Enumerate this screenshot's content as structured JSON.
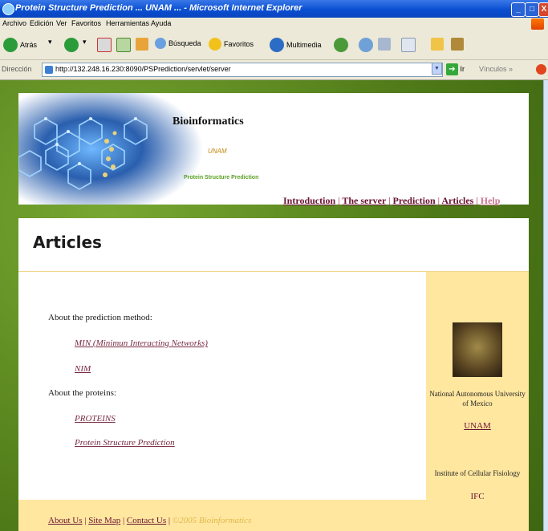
{
  "window": {
    "title": "Protein Structure Prediction ... UNAM ... - Microsoft Internet Explorer",
    "minimize": "_",
    "maximize": "□",
    "close": "X"
  },
  "menu": [
    "Archivo",
    "Edición",
    "Ver",
    "Favoritos",
    "Herramientas",
    "Ayuda"
  ],
  "toolbar": {
    "back": "Atrás",
    "search": "Búsqueda",
    "favorites": "Favoritos",
    "multimedia": "Multimedia"
  },
  "address": {
    "label": "Dirección",
    "url": "http://132.248.16.230:8090/PSPrediction/servlet/server",
    "go": "Ir",
    "links": "Vínculos"
  },
  "header": {
    "title": "Bioinformatics",
    "org": "UNAM",
    "subtitle": "Protein Structure Prediction",
    "nav": [
      "Introduction",
      "The server",
      "Prediction",
      "Articles",
      "Help"
    ],
    "sep": "|"
  },
  "main": {
    "page_title": "Articles",
    "method_heading": "About the prediction method:",
    "method_links": [
      "MIN (Minimun Interacting Networks)",
      "NIM"
    ],
    "proteins_heading": "About the proteins:",
    "protein_links": [
      "PROTEINS",
      "Protein Structure Prediction"
    ]
  },
  "sidebar": {
    "university": "National Autonomous University of Mexico",
    "unam_link": "UNAM",
    "institute": "Institute of Cellular Fisiology",
    "ifc_link": "IFC"
  },
  "footer": {
    "about": "About Us",
    "sitemap": "Site Map",
    "contact": "Contact Us",
    "copyright": "©2005 Bioinformatics",
    "sep": "|"
  },
  "colors": {
    "link": "#6b1232",
    "title_bar": "#0a4fd1",
    "sidebar_bg": "#ffe7a0",
    "background_green": "#5a8a1e"
  },
  "icons": [
    "ie-icon",
    "back-icon",
    "forward-icon",
    "stop-icon",
    "refresh-icon",
    "home-icon",
    "search-icon",
    "favorites-icon",
    "multimedia-icon",
    "history-icon",
    "mail-icon",
    "print-icon",
    "edit-icon",
    "messenger-icon",
    "folder-icon"
  ]
}
